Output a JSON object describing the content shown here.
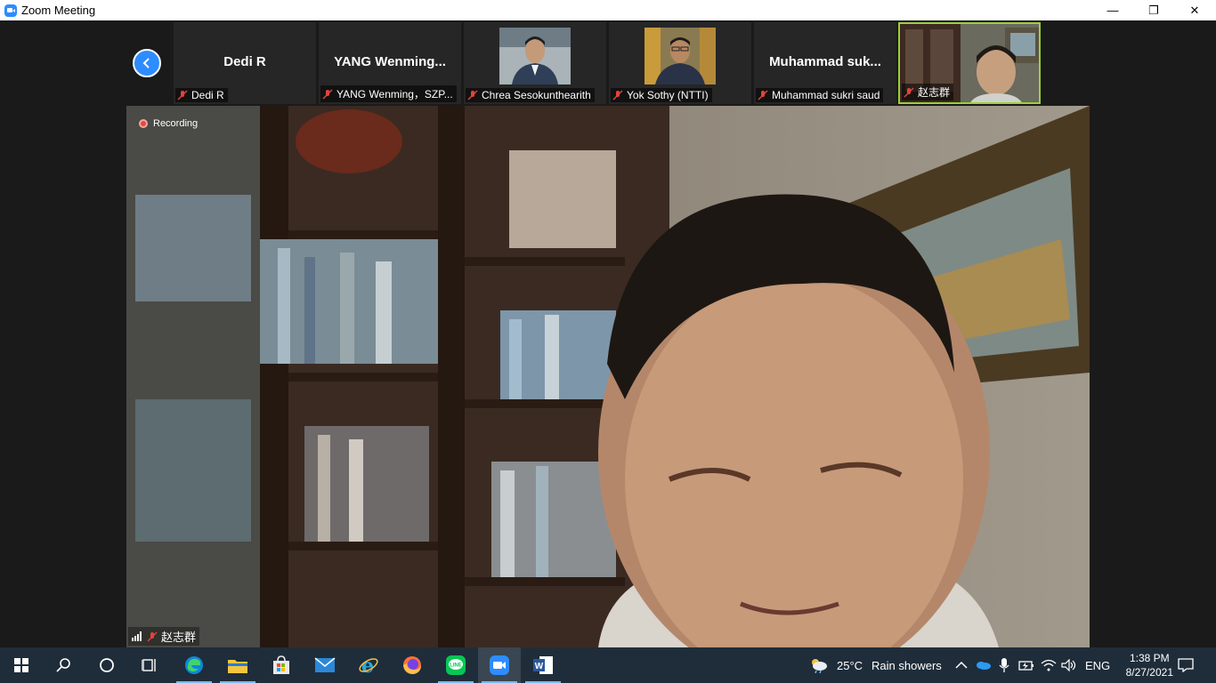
{
  "window": {
    "title": "Zoom Meeting",
    "minimize": "—",
    "restore": "❐",
    "close": "✕"
  },
  "gallery": {
    "participants": [
      {
        "big_name": "Dedi R",
        "name": "Dedi R",
        "has_video": false
      },
      {
        "big_name": "YANG  Wenming...",
        "name": "YANG Wenming，SZP...",
        "has_video": false
      },
      {
        "big_name": "",
        "name": "Chrea Sesokunthearith",
        "has_video": true
      },
      {
        "big_name": "",
        "name": "Yok Sothy (NTTI)",
        "has_video": true
      },
      {
        "big_name": "Muhammad  suk...",
        "name": "Muhammad sukri saud",
        "has_video": false
      },
      {
        "big_name": "",
        "name": "赵志群",
        "has_video": true,
        "active_speaker": true
      }
    ]
  },
  "main_video": {
    "recording_label": "Recording",
    "speaker_name": "赵志群"
  },
  "taskbar": {
    "apps": [
      "start-icon",
      "search-icon",
      "cortana-icon",
      "task-view-icon",
      "edge-icon",
      "file-explorer-icon",
      "store-icon",
      "mail-icon",
      "internet-explorer-icon",
      "firefox-icon",
      "line-icon",
      "zoom-icon",
      "word-icon"
    ],
    "weather_temp": "25°C",
    "weather_desc": "Rain showers",
    "language": "ENG",
    "time": "1:38 PM",
    "date": "8/27/2021"
  },
  "colors": {
    "accent": "#2d8cff",
    "active_border": "#9ccf3a",
    "taskbar": "#1f2d3a"
  }
}
